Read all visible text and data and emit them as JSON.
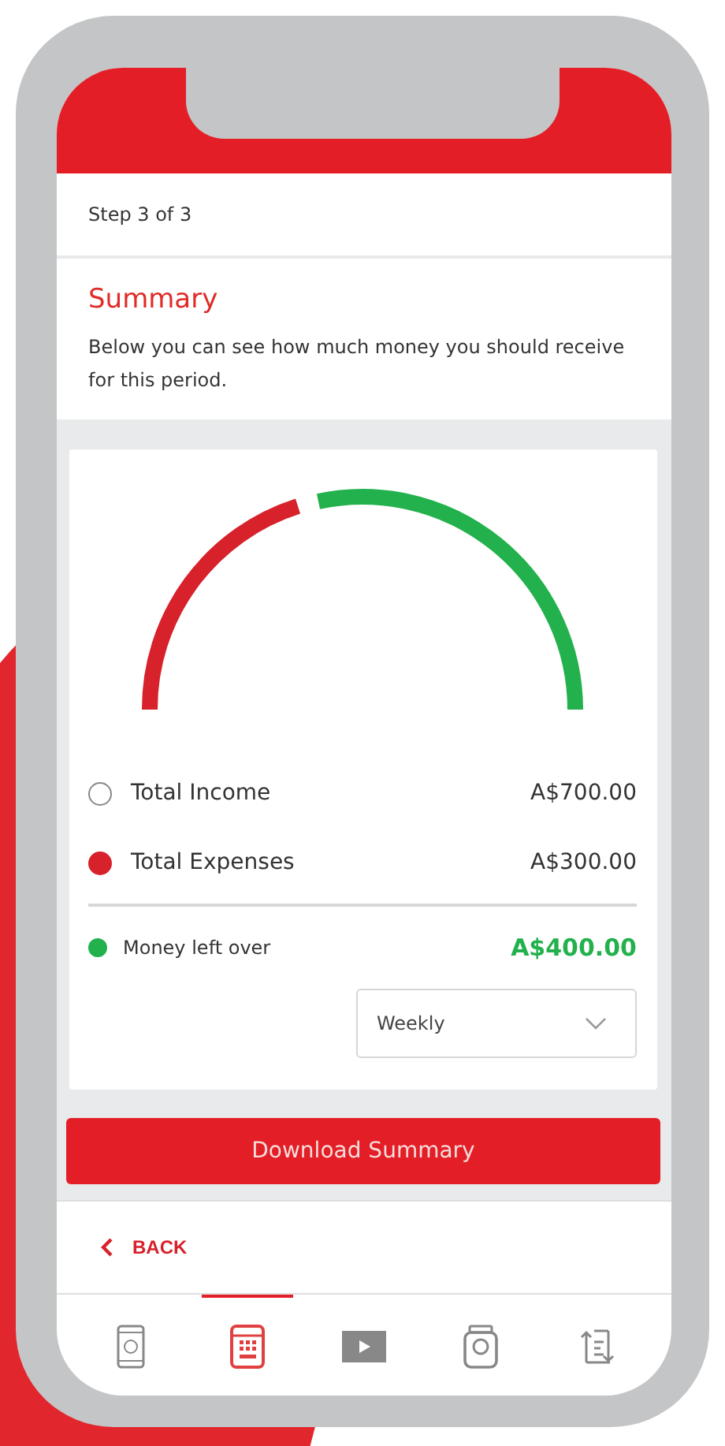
{
  "step": "Step 3 of 3",
  "summary": {
    "title": "Summary",
    "description": "Below you can see how much money you should receive for this period."
  },
  "totals": [
    {
      "label": "Total Income",
      "amount": "A$700.00",
      "color": "#ffffff"
    },
    {
      "label": "Total Expenses",
      "amount": "A$300.00",
      "color": "#d7212b"
    }
  ],
  "result": {
    "label": "Money left over",
    "amount": "A$400.00",
    "color": "#22b14c"
  },
  "period_select": {
    "value": "Weekly"
  },
  "download_button": "Download Summary",
  "back_link": "BACK",
  "nav": [
    {
      "kind": "phone",
      "selected": false
    },
    {
      "kind": "calculator",
      "selected": true
    },
    {
      "kind": "video",
      "selected": false
    },
    {
      "kind": "jar",
      "selected": false
    },
    {
      "kind": "list",
      "selected": false
    }
  ]
}
